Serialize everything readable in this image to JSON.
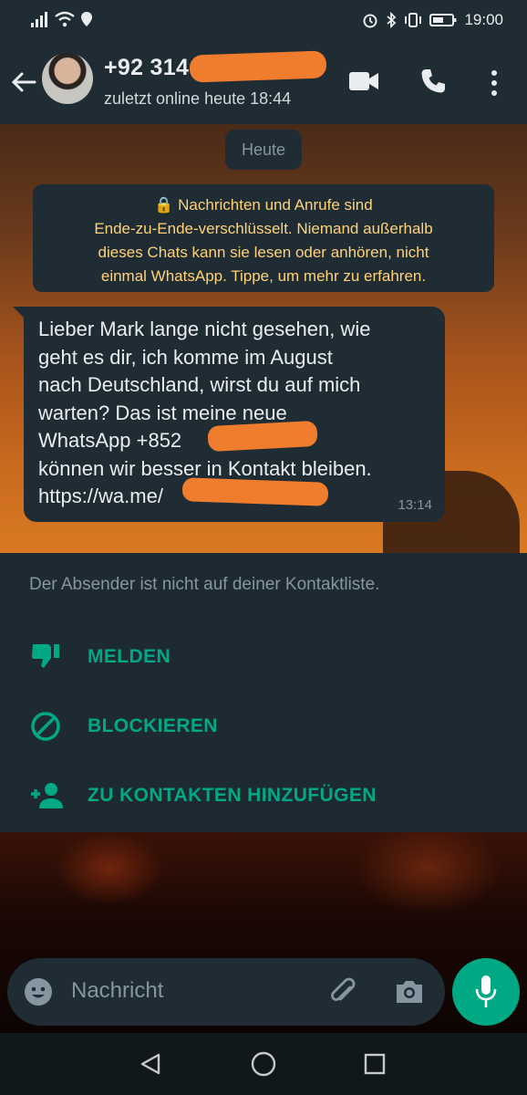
{
  "status_bar": {
    "time": "19:00",
    "icons": [
      "signal-icon",
      "wifi-icon",
      "location-icon",
      "alarm-icon",
      "bluetooth-icon",
      "vibrate-icon",
      "battery-icon"
    ]
  },
  "header": {
    "contact_number": "+92 314",
    "last_seen": "zuletzt online heute 18:44",
    "icons": [
      "back-arrow-icon",
      "video-call-icon",
      "voice-call-icon",
      "more-vert-icon"
    ]
  },
  "chat": {
    "date_chip": "Heute",
    "encryption_notice": "🔒 Nachrichten und Anrufe sind\nEnde-zu-Ende-verschlüsselt. Niemand außerhalb\ndieses Chats kann sie lesen oder anhören, nicht\neinmal WhatsApp. Tippe, um mehr zu erfahren.",
    "message": {
      "text": "Lieber Mark lange nicht gesehen, wie\ngeht es dir, ich komme im August\nnach Deutschland, wirst du auf mich\nwarten? Das ist meine neue\nWhatsApp +852              Hier\nkönnen wir besser in Kontakt bleiben.\nhttps://wa.me/",
      "time": "13:14"
    }
  },
  "unknown_sender_panel": {
    "info": "Der Absender ist nicht auf deiner Kontaktliste.",
    "actions": [
      {
        "label": "MELDEN",
        "icon": "thumb-down-icon"
      },
      {
        "label": "BLOCKIEREN",
        "icon": "block-icon"
      },
      {
        "label": "ZU KONTAKTEN HINZUFÜGEN",
        "icon": "add-contact-icon"
      }
    ]
  },
  "composer": {
    "placeholder": "Nachricht",
    "icons": [
      "emoji-icon",
      "attach-icon",
      "camera-icon",
      "mic-icon"
    ]
  },
  "colors": {
    "accent": "#00a884",
    "header_bg": "#1f2c34",
    "notice_text": "#ffd279",
    "redaction": "#f07c2e"
  }
}
